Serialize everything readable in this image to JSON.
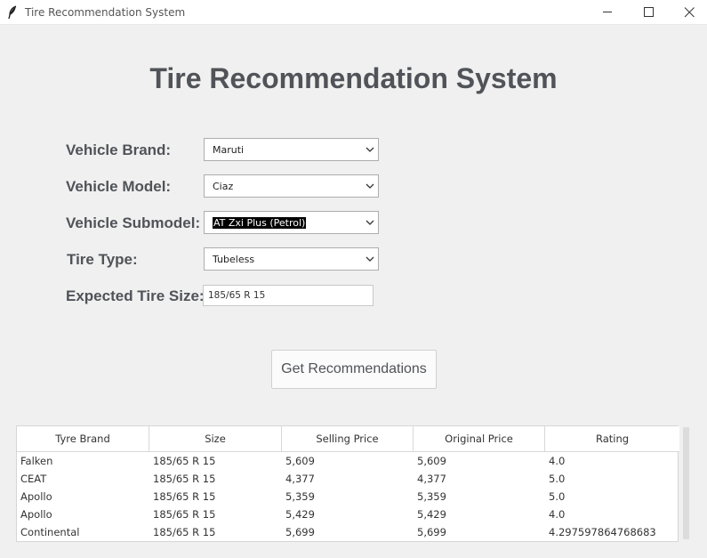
{
  "window": {
    "title": "Tire Recommendation System",
    "icon": "feather-icon"
  },
  "header": {
    "title": "Tire Recommendation System"
  },
  "form": {
    "brand_label": "Vehicle Brand:",
    "brand_value": "Maruti",
    "model_label": "Vehicle Model:",
    "model_value": "Ciaz",
    "submodel_label": "Vehicle Submodel:",
    "submodel_value": "AT Zxi Plus (Petrol)",
    "tire_type_label": "Tire Type:",
    "tire_type_value": "Tubeless",
    "size_label": "Expected Tire Size:",
    "size_value": "185/65 R 15"
  },
  "actions": {
    "recommend_label": "Get Recommendations"
  },
  "table": {
    "columns": [
      "Tyre Brand",
      "Size",
      "Selling Price",
      "Original Price",
      "Rating"
    ],
    "rows": [
      [
        "Falken",
        "185/65 R 15",
        "5,609",
        "5,609",
        "4.0"
      ],
      [
        "CEAT",
        "185/65 R 15",
        "4,377",
        "4,377",
        "5.0"
      ],
      [
        "Apollo",
        "185/65 R 15",
        "5,359",
        "5,359",
        "5.0"
      ],
      [
        "Apollo",
        "185/65 R 15",
        "5,429",
        "5,429",
        "4.0"
      ],
      [
        "Continental",
        "185/65 R 15",
        "5,699",
        "5,699",
        "4.297597864768683"
      ]
    ]
  }
}
